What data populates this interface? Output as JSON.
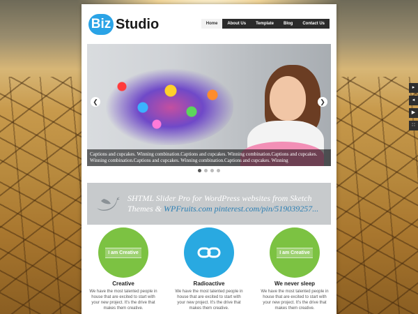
{
  "brand": {
    "logo_left": "Biz",
    "logo_right": "Studio"
  },
  "nav": {
    "items": [
      {
        "label": "Home",
        "active": true
      },
      {
        "label": "About Us",
        "active": false
      },
      {
        "label": "Template",
        "active": false
      },
      {
        "label": "Blog",
        "active": false
      },
      {
        "label": "Contact Us",
        "active": false
      }
    ]
  },
  "slider": {
    "caption": "Captions and cupcakes. Winning combination.Captions and cupcakes. Winning combination.Captions and cupcakes. Winning combination.Captions and cupcakes. Winning combination.Captions and cupcakes. Winning",
    "prev_icon": "chevron-left-icon",
    "next_icon": "chevron-right-icon",
    "dots": [
      true,
      false,
      false,
      false
    ]
  },
  "quote": {
    "text": "SHTML Slider Pro for WordPress websites from Sketch Themes & ",
    "link": "WPFruits.com pinterest.com/pin/519039257...",
    "icon": "twitter-bird-icon"
  },
  "features": [
    {
      "badge": "I am Creative",
      "icon": "",
      "title": "Creative",
      "text": "We have the most talented people in house that are excited to start with your new project. It's the drive that makes them creative.",
      "color": "#7cc242"
    },
    {
      "badge": "",
      "icon": "link-icon",
      "title": "Radioactive",
      "text": "We have the most talented people in house that are excited to start with your new project. It's the drive that makes them creative.",
      "color": "#29a9e1"
    },
    {
      "badge": "I am Creative",
      "icon": "",
      "title": "We never sleep",
      "text": "We have the most talented people in house that are excited to start with your new project. It's the drive that makes them creative.",
      "color": "#7cc242"
    }
  ],
  "sidebar": [
    "chevron-right-icon",
    "chevron-left-icon",
    "play-icon",
    "grid-icon"
  ]
}
